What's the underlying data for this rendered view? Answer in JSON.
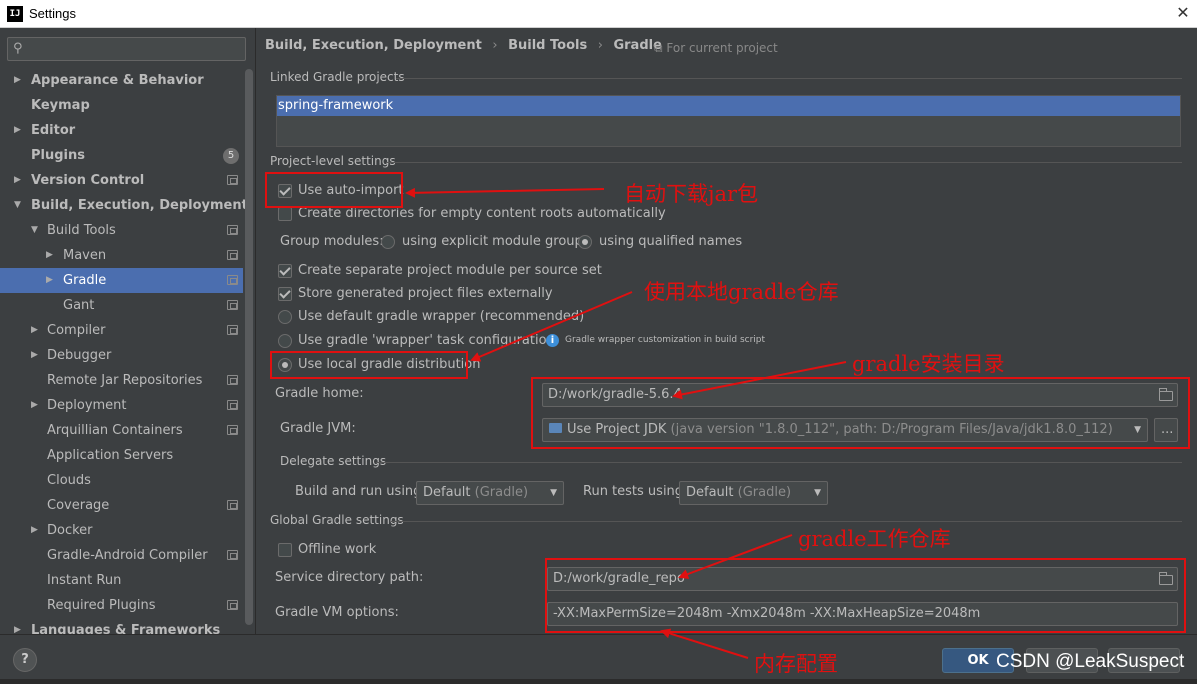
{
  "window": {
    "title": "Settings",
    "logo": "IJ",
    "close": "✕"
  },
  "search": {
    "placeholder": "",
    "icon": "search-icon"
  },
  "sidebar": {
    "items": [
      {
        "label": "Appearance & Behavior",
        "level": 0,
        "bold": true,
        "expandable": true,
        "expanded": false,
        "project": false
      },
      {
        "label": "Keymap",
        "level": 0,
        "bold": true,
        "expandable": false,
        "project": false
      },
      {
        "label": "Editor",
        "level": 0,
        "bold": true,
        "expandable": true,
        "expanded": false,
        "project": false
      },
      {
        "label": "Plugins",
        "level": 0,
        "bold": true,
        "expandable": false,
        "project": false,
        "badge": "5"
      },
      {
        "label": "Version Control",
        "level": 0,
        "bold": true,
        "expandable": true,
        "expanded": false,
        "project": true
      },
      {
        "label": "Build, Execution, Deployment",
        "level": 0,
        "bold": true,
        "expandable": true,
        "expanded": true,
        "project": false
      },
      {
        "label": "Build Tools",
        "level": 1,
        "bold": false,
        "expandable": true,
        "expanded": true,
        "project": true
      },
      {
        "label": "Maven",
        "level": 2,
        "bold": false,
        "expandable": true,
        "expanded": false,
        "project": true
      },
      {
        "label": "Gradle",
        "level": 2,
        "bold": false,
        "expandable": true,
        "expanded": false,
        "project": true,
        "selected": true
      },
      {
        "label": "Gant",
        "level": 2,
        "bold": false,
        "expandable": false,
        "project": true
      },
      {
        "label": "Compiler",
        "level": 1,
        "bold": false,
        "expandable": true,
        "expanded": false,
        "project": true
      },
      {
        "label": "Debugger",
        "level": 1,
        "bold": false,
        "expandable": true,
        "expanded": false,
        "project": false
      },
      {
        "label": "Remote Jar Repositories",
        "level": 1,
        "bold": false,
        "expandable": false,
        "project": true
      },
      {
        "label": "Deployment",
        "level": 1,
        "bold": false,
        "expandable": true,
        "expanded": false,
        "project": true
      },
      {
        "label": "Arquillian Containers",
        "level": 1,
        "bold": false,
        "expandable": false,
        "project": true
      },
      {
        "label": "Application Servers",
        "level": 1,
        "bold": false,
        "expandable": false,
        "project": false
      },
      {
        "label": "Clouds",
        "level": 1,
        "bold": false,
        "expandable": false,
        "project": false
      },
      {
        "label": "Coverage",
        "level": 1,
        "bold": false,
        "expandable": false,
        "project": true
      },
      {
        "label": "Docker",
        "level": 1,
        "bold": false,
        "expandable": true,
        "expanded": false,
        "project": false
      },
      {
        "label": "Gradle-Android Compiler",
        "level": 1,
        "bold": false,
        "expandable": false,
        "project": true
      },
      {
        "label": "Instant Run",
        "level": 1,
        "bold": false,
        "expandable": false,
        "project": false
      },
      {
        "label": "Required Plugins",
        "level": 1,
        "bold": false,
        "expandable": false,
        "project": true
      },
      {
        "label": "Languages & Frameworks",
        "level": 0,
        "bold": true,
        "expandable": true,
        "expanded": false,
        "project": false
      }
    ]
  },
  "breadcrumb": {
    "part1": "Build, Execution, Deployment",
    "part2": "Build Tools",
    "part3": "Gradle",
    "sep": "›",
    "scope": "For current project"
  },
  "linked": {
    "title": "Linked Gradle projects",
    "item": "spring-framework"
  },
  "project_level": {
    "title": "Project-level settings",
    "auto_import": "Use auto-import",
    "create_dirs": "Create directories for empty content roots automatically",
    "group_modules": "Group modules:",
    "group_explicit": "using explicit module groups",
    "group_qualified": "using qualified names",
    "separate_module": "Create separate project module per source set",
    "store_external": "Store generated project files externally",
    "default_wrapper": "Use default gradle wrapper (recommended)",
    "wrapper_task": "Use gradle 'wrapper' task configuration",
    "wrapper_hint": "Gradle wrapper customization in build script",
    "local_dist": "Use local gradle distribution",
    "gradle_home_label": "Gradle home:",
    "gradle_home_value": "D:/work/gradle-5.6.4",
    "gradle_jvm_label": "Gradle JVM:",
    "gradle_jvm_value": "Use Project JDK",
    "gradle_jvm_detail": "(java version \"1.8.0_112\", path: D:/Program Files/Java/jdk1.8.0_112)",
    "browse": "..."
  },
  "delegate": {
    "title": "Delegate settings",
    "build_run_label": "Build and run using",
    "build_run_value": "Default",
    "build_run_detail": "(Gradle)",
    "tests_label": "Run tests using",
    "tests_value": "Default",
    "tests_detail": "(Gradle)"
  },
  "global": {
    "title": "Global Gradle settings",
    "offline": "Offline work",
    "service_dir_label": "Service directory path:",
    "service_dir_value": "D:/work/gradle_repo",
    "vm_options_label": "Gradle VM options:",
    "vm_options_value": "-XX:MaxPermSize=2048m -Xmx2048m -XX:MaxHeapSize=2048m"
  },
  "buttons": {
    "help": "?",
    "ok": "OK"
  },
  "annotations": {
    "auto_jar": "自动下载jar包",
    "local_gradle": "使用本地gradle仓库",
    "install_dir": "gradle安装目录",
    "work_repo": "gradle工作仓库",
    "memory": "内存配置"
  },
  "watermark": "CSDN @LeakSuspect",
  "colors": {
    "background": "#3c3f41",
    "selection": "#4b6eaf",
    "annotation": "#e01010",
    "ok_button": "#365880"
  }
}
